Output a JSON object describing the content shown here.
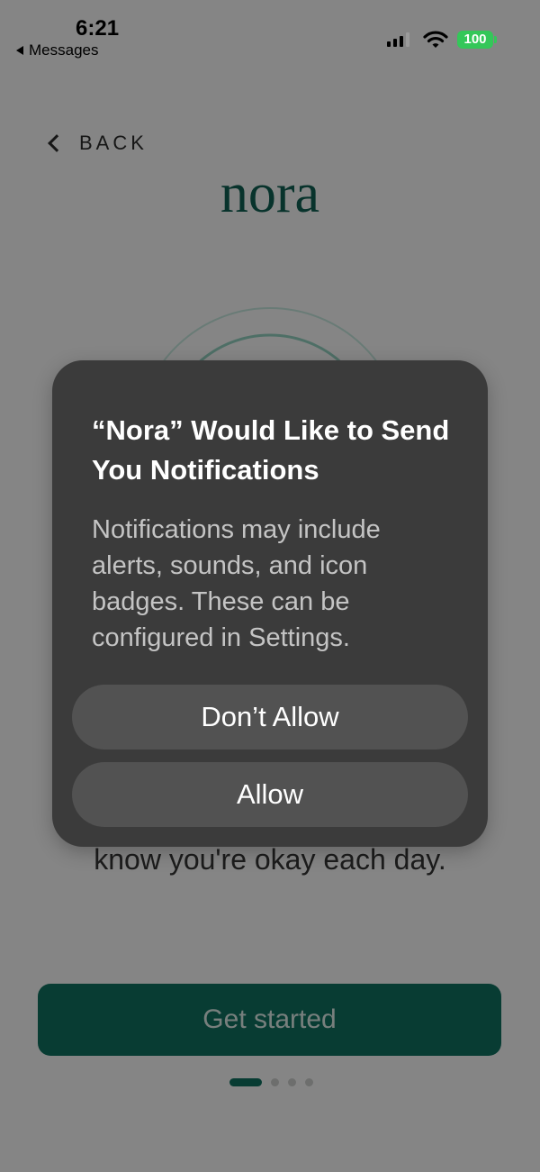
{
  "status_bar": {
    "time": "6:21",
    "back_app": "Messages",
    "battery": "100",
    "battery_color": "#34c759"
  },
  "nav": {
    "back_label": "BACK"
  },
  "brand": {
    "logo": "nora",
    "color": "#0f5d50"
  },
  "main": {
    "subtitle": "know you're okay each day.",
    "cta_label": "Get started",
    "pager": {
      "total": 4,
      "active_index": 0
    }
  },
  "alert": {
    "title": "“Nora” Would Like to Send You Notifications",
    "message": "Notifications may include alerts, sounds, and icon badges. These can be configured in Settings.",
    "deny_label": "Don’t Allow",
    "allow_label": "Allow"
  }
}
